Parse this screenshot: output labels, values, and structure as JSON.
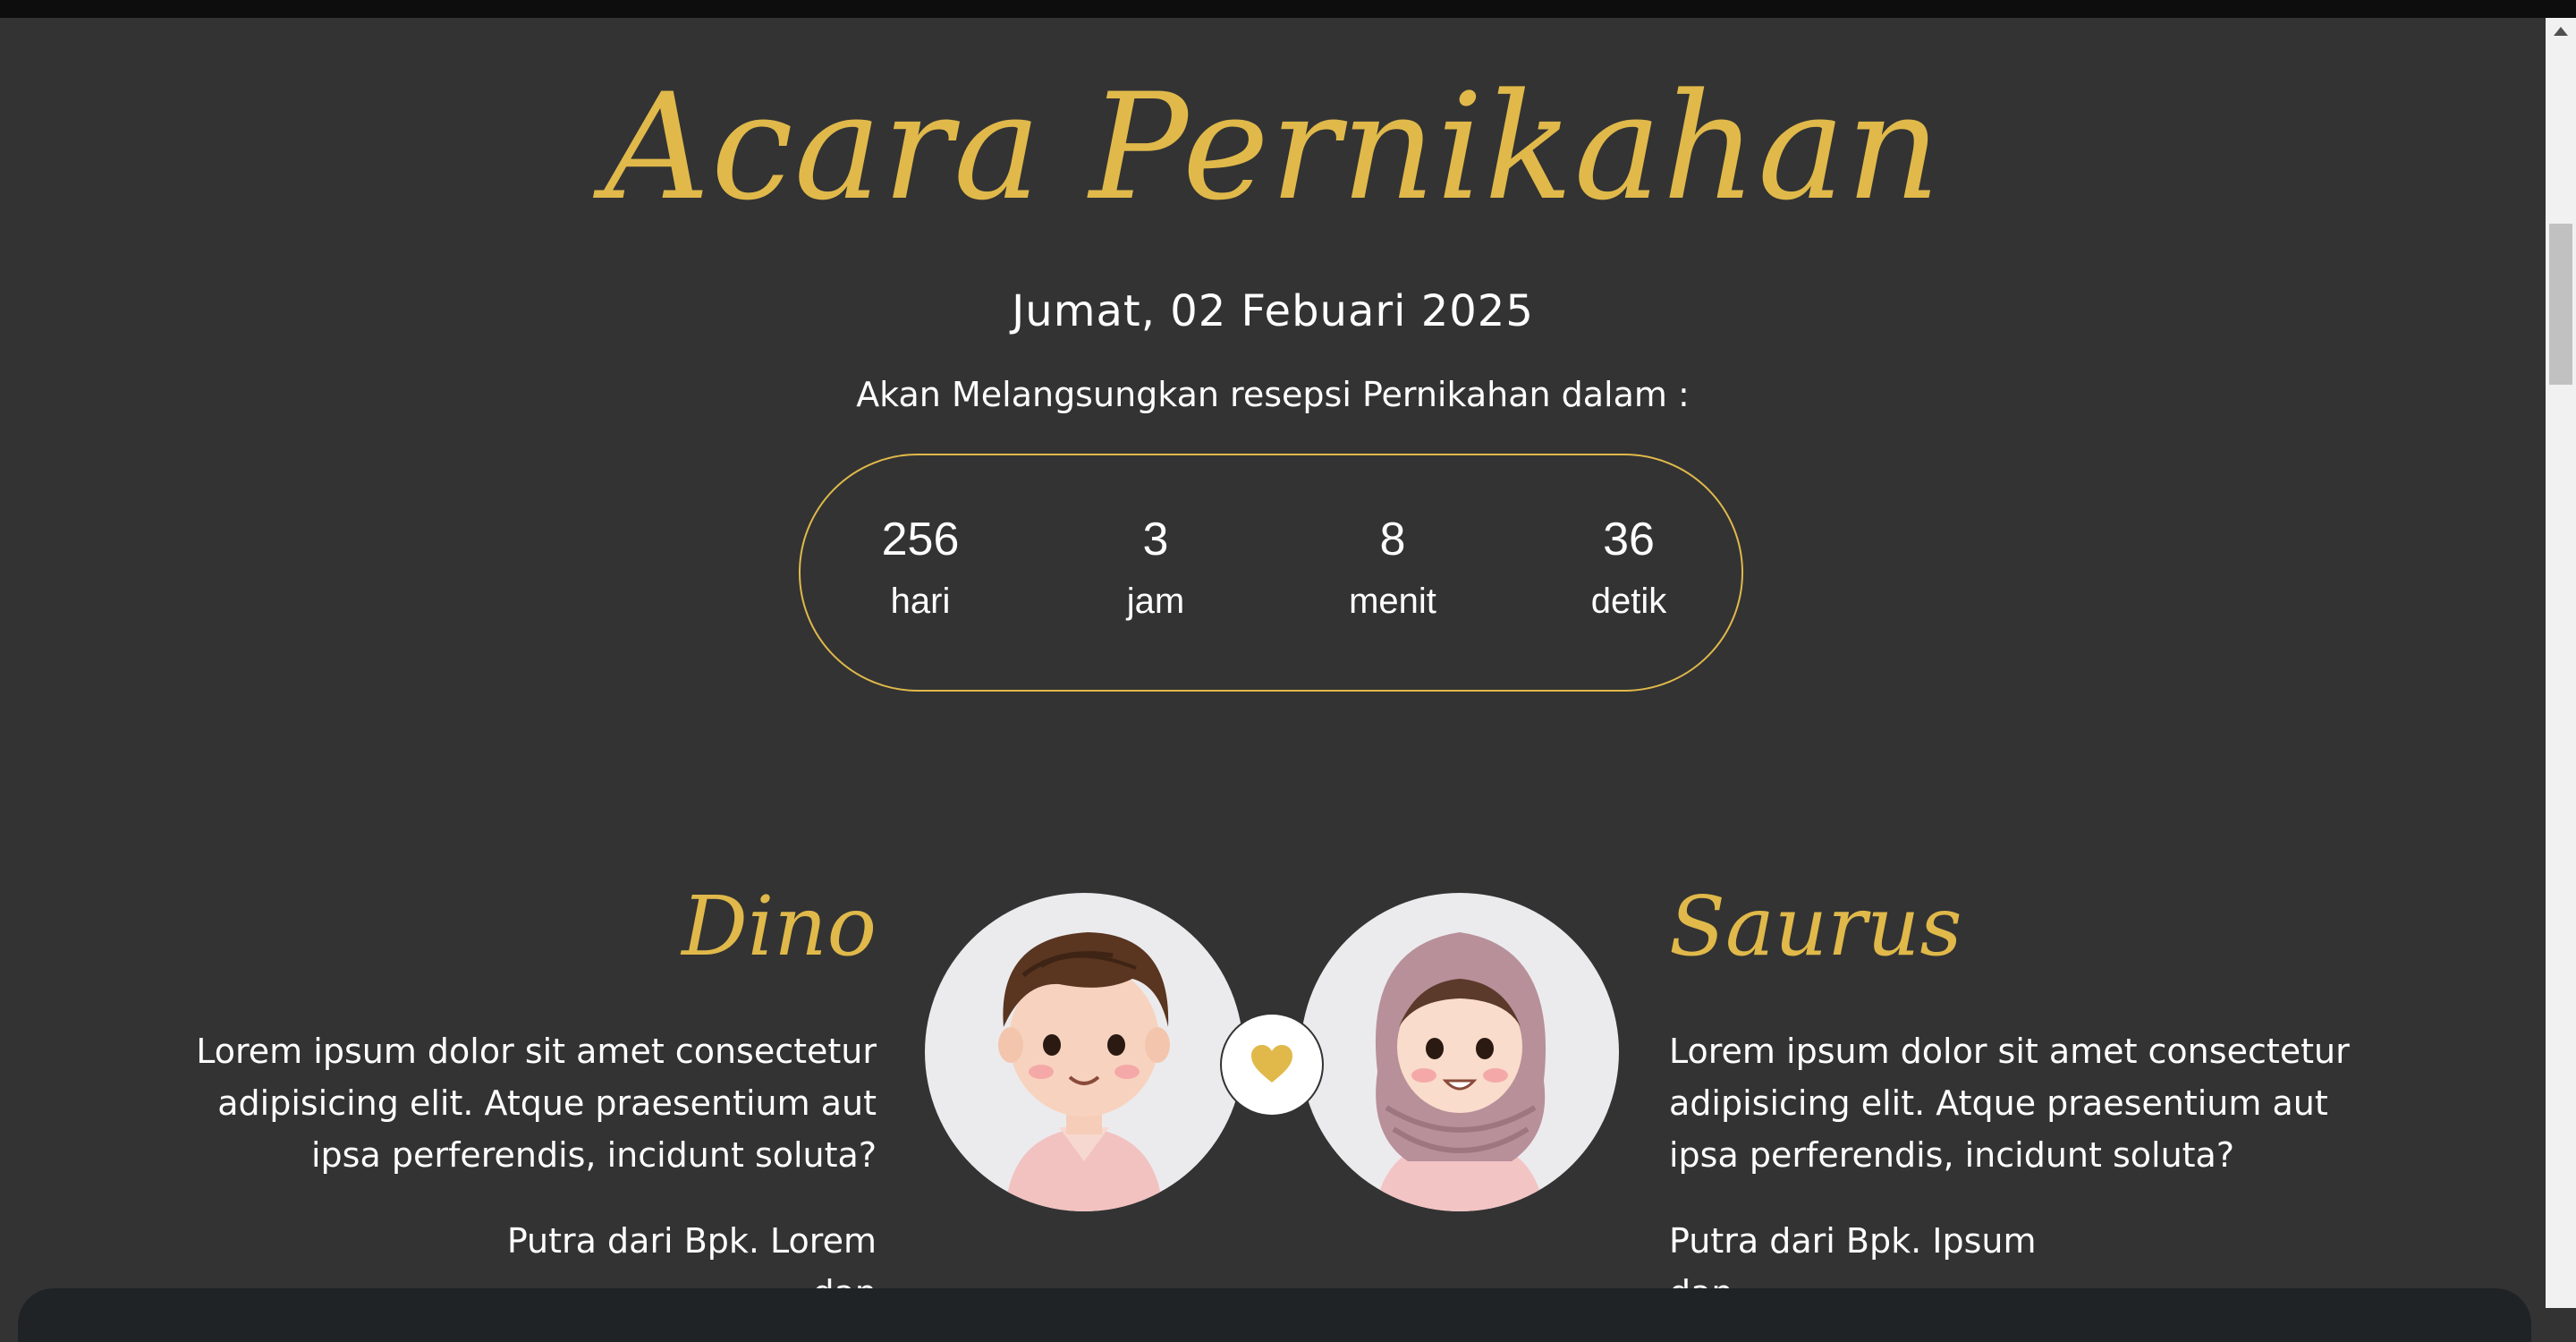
{
  "colors": {
    "accent": "#e0b94a",
    "background": "#333333",
    "text": "#ffffff"
  },
  "header": {
    "title": "Acara Pernikahan",
    "date": "Jumat, 02 Febuari 2025",
    "subtitle": "Akan Melangsungkan resepsi Pernikahan dalam :"
  },
  "countdown": [
    {
      "value": "256",
      "label": "hari"
    },
    {
      "value": "3",
      "label": "jam"
    },
    {
      "value": "8",
      "label": "menit"
    },
    {
      "value": "36",
      "label": "detik"
    }
  ],
  "couple": {
    "groom": {
      "name": "Dino",
      "bio": "Lorem ipsum dolor sit amet consectetur adipisicing elit. Atque praesentium aut ipsa perferendis, incidunt soluta?",
      "parents": "Putra dari Bpk. Lorem",
      "parents_cont": "dan"
    },
    "bride": {
      "name": "Saurus",
      "bio": "Lorem ipsum dolor sit amet consectetur adipisicing elit. Atque praesentium aut ipsa perferendis, incidunt soluta?",
      "parents": "Putra dari Bpk. Ipsum",
      "parents_cont": "dan"
    },
    "heart_icon": "heart-icon"
  }
}
